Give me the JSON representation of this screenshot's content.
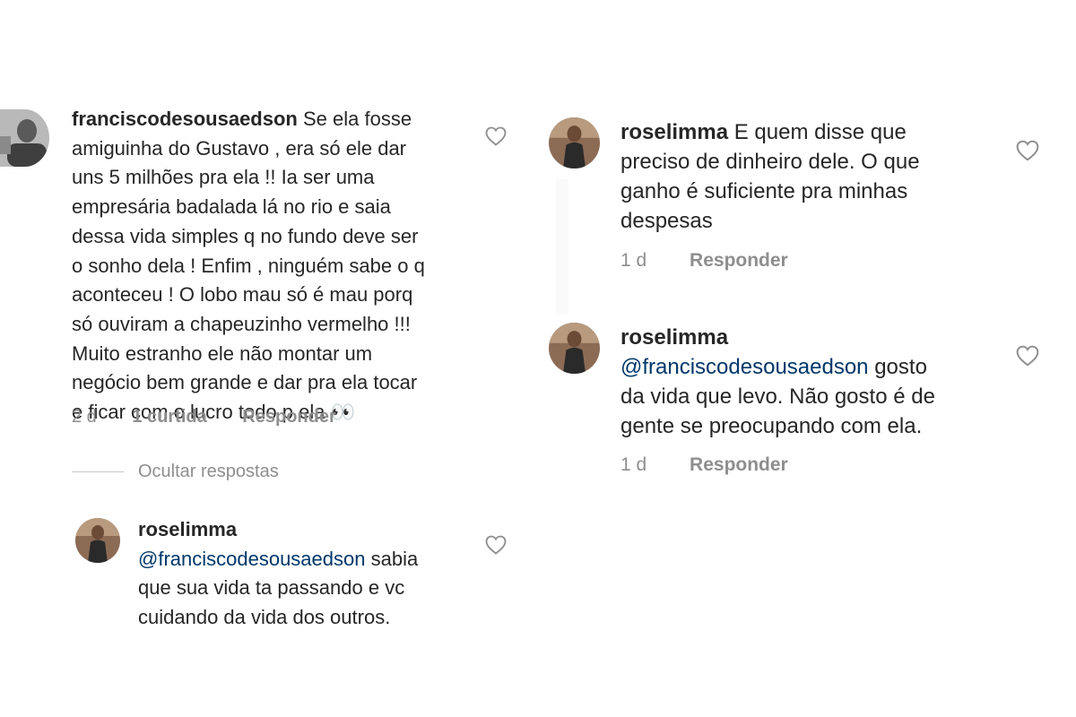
{
  "comments": [
    {
      "username": "franciscodesousaedson",
      "lines": [
        " Se ela fosse",
        "amiguinha do Gustavo , era só ele dar",
        "uns 5 milhões pra ela !! Ia ser uma",
        "empresária badalada lá no rio e saia",
        "dessa vida simples q no fundo deve ser",
        "o sonho dela ! Enfim , ninguém sabe o q",
        "aconteceu ! O lobo mau só é mau porq",
        "só ouviram a chapeuzinho vermelho !!!",
        "Muito estranho ele não montar um",
        "negócio bem grande e dar pra ela tocar",
        "e ficar com o lucro todo p ela 👀"
      ],
      "time": "2 d",
      "likes": "1 curtida",
      "reply": "Responder",
      "avatar_icon": "user-avatar-man"
    },
    {
      "username": "roselimma",
      "mention": "@franciscodesousaedson",
      "lines": [
        " sabia",
        "que sua vida  ta passando e vc",
        "cuidando da vida dos outros."
      ],
      "avatar_icon": "user-avatar-woman"
    },
    {
      "username": "roselimma",
      "lines": [
        " E quem disse que",
        "preciso de dinheiro dele. O que",
        "ganho é suficiente pra minhas",
        "despesas"
      ],
      "time": "1 d",
      "reply": "Responder",
      "avatar_icon": "user-avatar-woman"
    },
    {
      "username": "roselimma",
      "mention": "@franciscodesousaedson",
      "lines": [
        " gosto",
        "da vida que levo. Não gosto é de",
        "gente se preocupando com ela."
      ],
      "time": "1 d",
      "reply": "Responder",
      "avatar_icon": "user-avatar-woman"
    }
  ],
  "hide_replies_label": "Ocultar respostas",
  "colors": {
    "text": "#262626",
    "secondary": "#8e8e8e",
    "mention": "#00376b",
    "heart_stroke": "#8e8e8e"
  },
  "icons": {
    "like": "heart-outline-icon"
  }
}
